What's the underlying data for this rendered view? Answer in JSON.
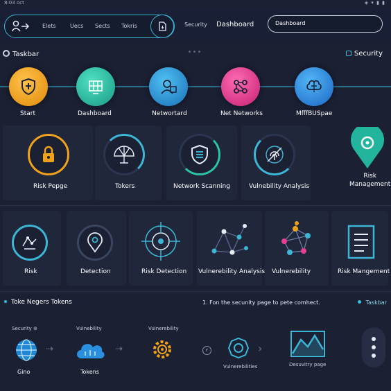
{
  "status": {
    "left": "8:03 oct",
    "right": "◈ ▾ ▮ ▮"
  },
  "nav": {
    "links": [
      "Elets",
      "Uecs",
      "Sects",
      "Tokris"
    ],
    "header_security": "Security",
    "header_dashboard": "Dashboard",
    "search_value": "Dashboard"
  },
  "taskbar": {
    "title": "Taskbar",
    "security_link": "Security"
  },
  "row1": [
    {
      "label": "Start",
      "color": "#f0a319",
      "icon": "shield-icon"
    },
    {
      "label": "Dashboard",
      "color": "#2bc4a4",
      "icon": "grid-icon"
    },
    {
      "label": "Networtard",
      "color": "#2ba1dd",
      "icon": "network-user-icon"
    },
    {
      "label": "Net Networks",
      "color": "#e83e94",
      "icon": "network-nodes-icon"
    },
    {
      "label": "MfffBUSpae",
      "color": "#2b8fe0",
      "icon": "brain-icon"
    }
  ],
  "row2": [
    {
      "label": "Risk Pepge",
      "icon": "lock-icon"
    },
    {
      "label": "Tokers",
      "icon": "radar-icon"
    },
    {
      "label": "Network Scanning",
      "icon": "shield-scan-icon"
    },
    {
      "label": "Vulnebility Analysis",
      "icon": "fingerprint-icon"
    },
    {
      "label": "Risk\nManagement",
      "icon": "location-pin-icon"
    }
  ],
  "row3": [
    {
      "label": "Risk",
      "icon": "map-target-icon"
    },
    {
      "label": "Detection",
      "icon": "detection-pin-icon"
    },
    {
      "label": "Risk Detection",
      "icon": "crosshair-icon"
    },
    {
      "label": "Vulnerebility Analysis",
      "icon": "node-graph-icon"
    },
    {
      "label": "Vulnerebility",
      "icon": "colored-nodes-icon"
    },
    {
      "label": "Risk Mangement",
      "icon": "document-icon"
    }
  ],
  "tokens": {
    "title": "Toke Negers Tokens",
    "note": "1. Fon the secunity page to pete comhect.",
    "taskbar_link": "Taskbar",
    "flow": [
      {
        "top": "Security ⊚",
        "label": "Gino",
        "icon": "globe-icon"
      },
      {
        "top": "Vulnebility",
        "label": "Tokens",
        "icon": "cloud-icon"
      },
      {
        "top": "Vulnerebility",
        "label": "",
        "icon": "gear-icon"
      }
    ],
    "right_flow": [
      {
        "label": "Vulnerebilities",
        "icon": "virus-icon"
      },
      {
        "label": "Desuvitry page",
        "icon": "chart-icon"
      }
    ],
    "step_marker": "r"
  }
}
